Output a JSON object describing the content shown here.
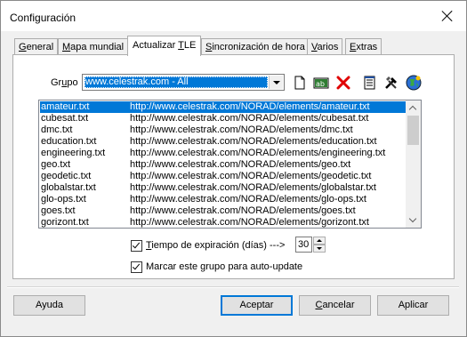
{
  "window": {
    "title": "Configuración"
  },
  "tabs": [
    {
      "label_pre": "",
      "mnemonic": "G",
      "label_post": "eneral"
    },
    {
      "label_pre": "",
      "mnemonic": "M",
      "label_post": "apa mundial"
    },
    {
      "label_pre": "Actualizar ",
      "mnemonic": "T",
      "label_post": "LE"
    },
    {
      "label_pre": "",
      "mnemonic": "S",
      "label_post": "incronización de hora"
    },
    {
      "label_pre": "",
      "mnemonic": "V",
      "label_post": "arios"
    },
    {
      "label_pre": "",
      "mnemonic": "E",
      "label_post": "xtras"
    }
  ],
  "active_tab": "Actualizar TLE",
  "group": {
    "label_pre": "Gr",
    "mnemonic": "u",
    "label_post": "po",
    "selected": "www.celestrak.com - All"
  },
  "toolbar": {
    "buttons": [
      "new-file-icon",
      "rename-icon",
      "delete-icon",
      "notepad-icon",
      "tools-icon",
      "update-globe-icon"
    ],
    "delete_color": "#e00000"
  },
  "tle_list": [
    {
      "name": "amateur.txt",
      "url": "http://www.celestrak.com/NORAD/elements/amateur.txt",
      "selected": true
    },
    {
      "name": "cubesat.txt",
      "url": "http://www.celestrak.com/NORAD/elements/cubesat.txt"
    },
    {
      "name": "dmc.txt",
      "url": "http://www.celestrak.com/NORAD/elements/dmc.txt"
    },
    {
      "name": "education.txt",
      "url": "http://www.celestrak.com/NORAD/elements/education.txt"
    },
    {
      "name": "engineering.txt",
      "url": "http://www.celestrak.com/NORAD/elements/engineering.txt"
    },
    {
      "name": "geo.txt",
      "url": "http://www.celestrak.com/NORAD/elements/geo.txt"
    },
    {
      "name": "geodetic.txt",
      "url": "http://www.celestrak.com/NORAD/elements/geodetic.txt"
    },
    {
      "name": "globalstar.txt",
      "url": "http://www.celestrak.com/NORAD/elements/globalstar.txt"
    },
    {
      "name": "glo-ops.txt",
      "url": "http://www.celestrak.com/NORAD/elements/glo-ops.txt"
    },
    {
      "name": "goes.txt",
      "url": "http://www.celestrak.com/NORAD/elements/goes.txt"
    },
    {
      "name": "gorizont.txt",
      "url": "http://www.celestrak.com/NORAD/elements/gorizont.txt"
    }
  ],
  "expiry": {
    "checked": true,
    "mnemonic": "T",
    "label_post": "iempo de expiración (días) --->",
    "value": "30"
  },
  "autoupdate": {
    "checked": true,
    "label": "Marcar este grupo para auto-update"
  },
  "buttons": {
    "help": "Ayuda",
    "accept": "Aceptar",
    "cancel_mnemonic": "C",
    "cancel_post": "ancelar",
    "apply": "Aplicar"
  },
  "colors": {
    "selection": "#0078d7",
    "accent": "#0078d7"
  }
}
